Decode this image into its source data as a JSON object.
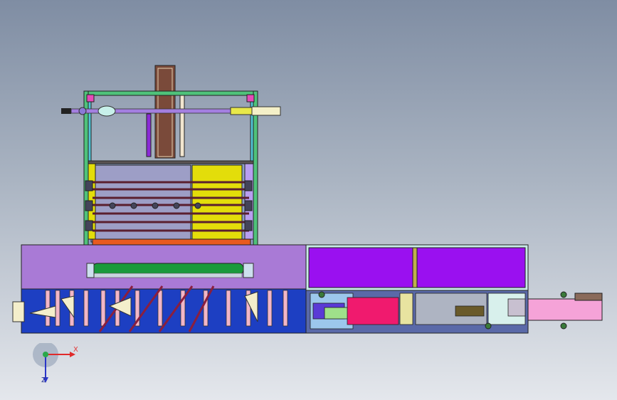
{
  "viewport": {
    "background_top": "#7f8da3",
    "background_bottom": "#e4e7ec",
    "model_colors": {
      "frame_green": "#4fc27a",
      "purple_panel": "#a97ad6",
      "violet_box": "#9a10f0",
      "blue_base": "#1d3fc2",
      "yellow_block": "#e3dd0a",
      "magenta_block": "#f01a6e",
      "pink_conveyor": "#f5a3d8",
      "brown_column": "#7a4a3a",
      "green_roller": "#1a9a3b",
      "maroon_strut": "#8a1f3e"
    }
  },
  "triad": {
    "x_label": "X",
    "z_label": "Z",
    "x_color": "#e02a2a",
    "y_color": "#2aa84a",
    "z_color": "#2a36c8"
  }
}
